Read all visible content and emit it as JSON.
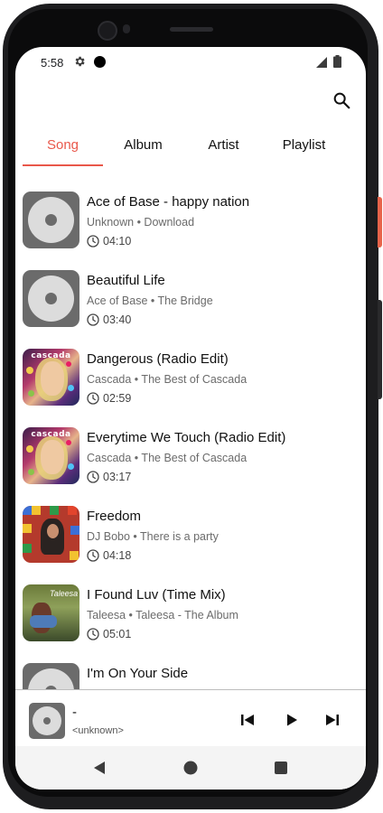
{
  "status_bar": {
    "time": "5:58",
    "icons": [
      "gear-icon",
      "notification-dot-icon",
      "cell-signal-icon",
      "battery-icon"
    ]
  },
  "toolbar": {
    "search_icon": "search-icon"
  },
  "tabs": [
    {
      "label": "Song",
      "active": true
    },
    {
      "label": "Album",
      "active": false
    },
    {
      "label": "Artist",
      "active": false
    },
    {
      "label": "Playlist",
      "active": false
    }
  ],
  "songs": [
    {
      "title": "Ace of Base - happy nation",
      "subtitle": "Unknown • Download",
      "duration": "04:10",
      "art": "disc-placeholder"
    },
    {
      "title": "Beautiful Life",
      "subtitle": "Ace of Base • The Bridge",
      "duration": "03:40",
      "art": "disc-placeholder"
    },
    {
      "title": "Dangerous (Radio Edit)",
      "subtitle": "Cascada • The Best of Cascada",
      "duration": "02:59",
      "art": "cascada-cover",
      "art_text": "cascada"
    },
    {
      "title": "Everytime We Touch (Radio Edit)",
      "subtitle": "Cascada • The Best of Cascada",
      "duration": "03:17",
      "art": "cascada-cover",
      "art_text": "cascada"
    },
    {
      "title": "Freedom",
      "subtitle": "DJ Bobo • There is a party",
      "duration": "04:18",
      "art": "freedom-cover"
    },
    {
      "title": "I Found Luv (Time Mix)",
      "subtitle": "Taleesa • Taleesa - The Album",
      "duration": "05:01",
      "art": "taleesa-cover",
      "art_text": "Taleesa"
    },
    {
      "title": "I'm On Your Side",
      "subtitle": "",
      "duration": "",
      "art": "disc-placeholder"
    }
  ],
  "now_playing": {
    "title": "-",
    "artist": "<unknown>",
    "controls": [
      "skip-previous-icon",
      "play-icon",
      "skip-next-icon"
    ]
  },
  "nav_bar": {
    "buttons": [
      "back-icon",
      "home-icon",
      "recents-icon"
    ]
  },
  "colors": {
    "accent": "#e9574a",
    "placeholder_art": "#6b6b6b",
    "divider": "#bdbdbd"
  }
}
